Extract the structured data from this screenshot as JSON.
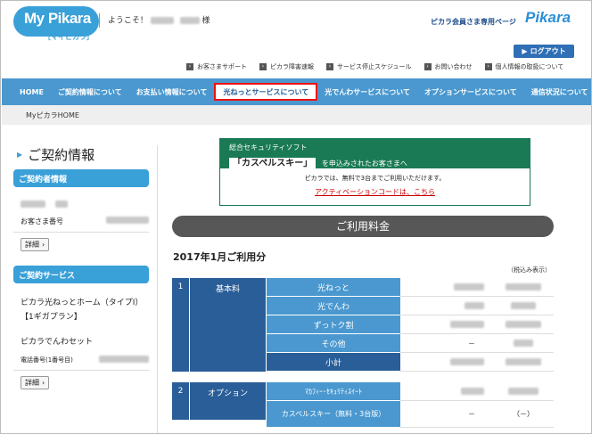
{
  "header": {
    "logo_text": "My Pikara",
    "logo_sub": "［マイピカラ］",
    "welcome": "ようこそ！",
    "welcome_suffix": "様",
    "member_page": "ピカラ会員さま専用ページ",
    "brand": "Pikara",
    "logout": "ログアウト"
  },
  "util_links": [
    "お客さまサポート",
    "ピカラ障害速報",
    "サービス停止スケジュール",
    "お問い合わせ",
    "個人情報の取扱について"
  ],
  "nav": [
    {
      "label": "HOME"
    },
    {
      "label": "ご契約情報について"
    },
    {
      "label": "お支払い情報について"
    },
    {
      "label": "光ねっとサービスについて"
    },
    {
      "label": "光でんわサービスについて"
    },
    {
      "label": "オプションサービスについて"
    },
    {
      "label": "通信状況について"
    }
  ],
  "breadcrumb": "MyピカラHOME",
  "sidebar": {
    "title": "ご契約情報",
    "contract_holder_head": "ご契約者情報",
    "customer_number_label": "お客さま番号",
    "detail_label": "詳細",
    "service_head": "ご契約サービス",
    "service_1": "ピカラ光ねっとホーム（タイプⅠ）【1ギガプラン】",
    "service_2": "ピカラでんわセット",
    "phone_label": "電話番号(1番号目)"
  },
  "banner": {
    "line1": "総合セキュリティソフト",
    "product": "「カスペルスキー」",
    "line2": "を申込みされたお客さまへ",
    "note": "ピカラでは、無料で3台までご利用いただけます。",
    "link": "アクティベーションコードは、こちら"
  },
  "fee_bar": "ご利用料金",
  "usage_title": "2017年1月ご利用分",
  "tax_note": "（税込み表示）",
  "table": {
    "section1": {
      "num": "1",
      "category": "基本料"
    },
    "rows1": [
      {
        "item": "光ねっと"
      },
      {
        "item": "光でんわ"
      },
      {
        "item": "ずっトク割"
      },
      {
        "item": "その他",
        "v1": "－"
      },
      {
        "item": "小計"
      }
    ],
    "section2": {
      "num": "2",
      "category": "オプション"
    },
    "rows2": [
      {
        "item": "ﾏｶﾌｨｰ･ｾｷｭﾘﾃｨｽｲｰﾄ"
      },
      {
        "item": "カスペルスキー（無料・3台版）",
        "v1": "－",
        "v2": "（－）"
      }
    ]
  }
}
